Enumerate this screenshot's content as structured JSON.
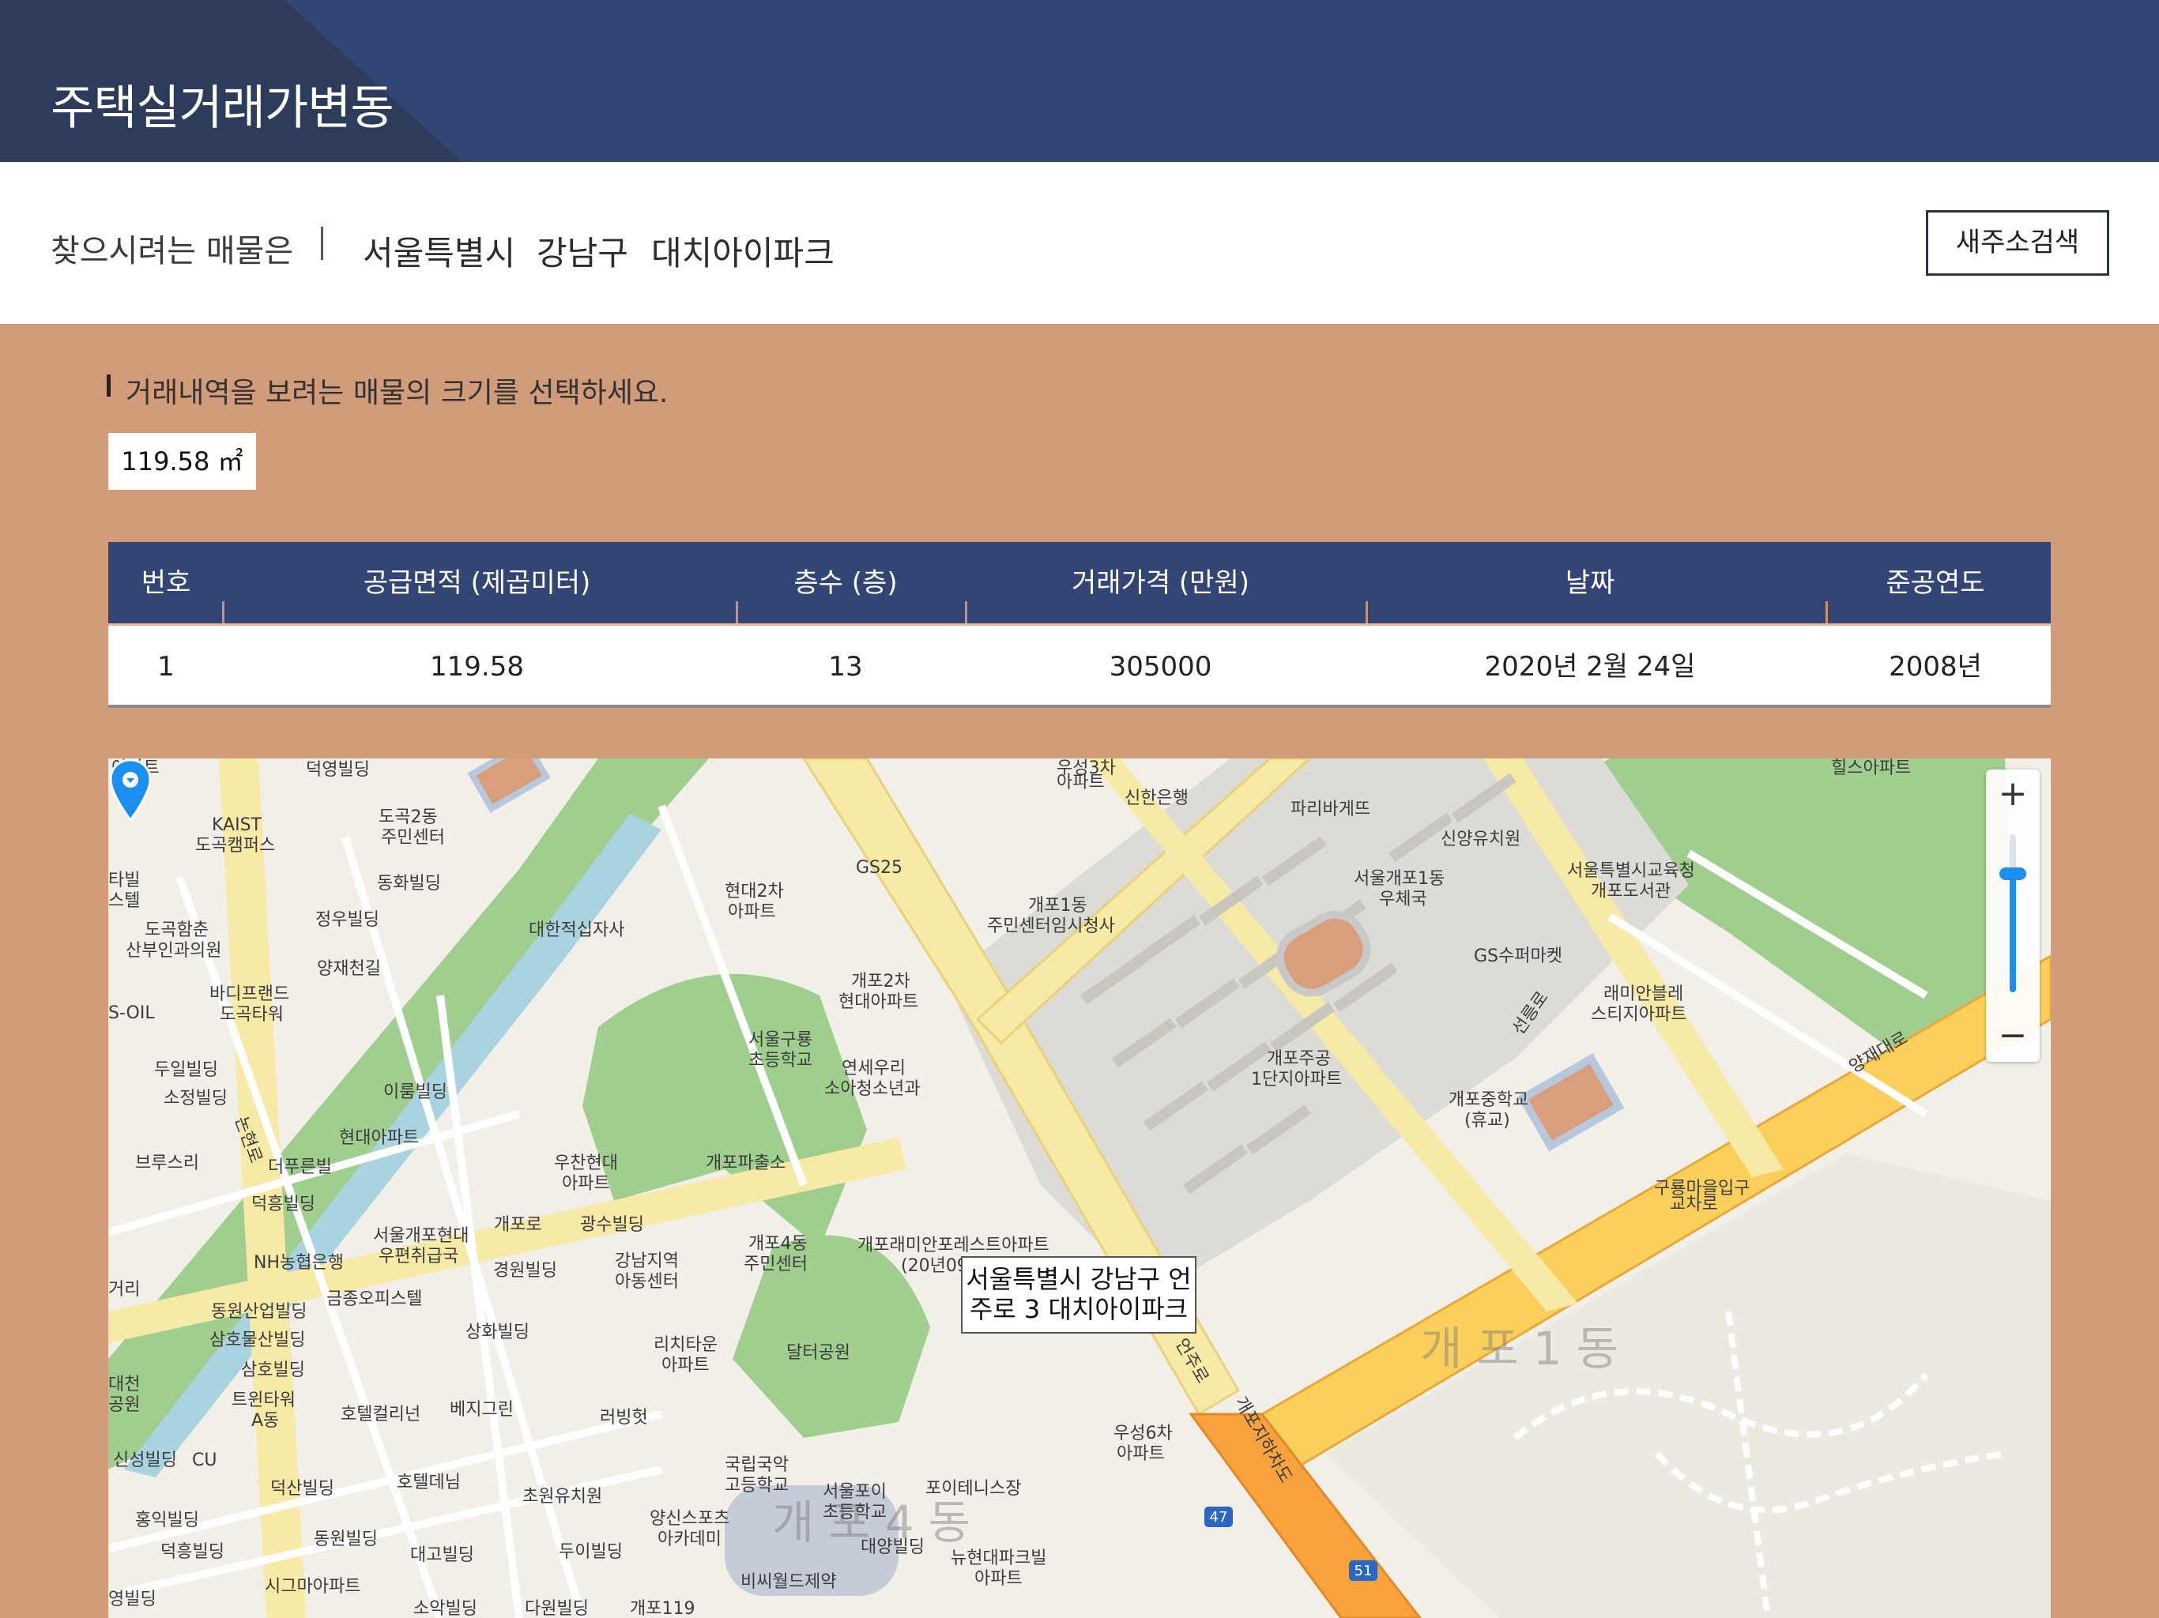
{
  "header": {
    "title": "주택실거래가변동"
  },
  "search": {
    "lead": "찾으시려는 매물은",
    "city": "서울특별시",
    "district": "강남구",
    "complex": "대치아이파크",
    "new_search_label": "새주소검색"
  },
  "size_select": {
    "instruction": "거래내역을 보려는 매물의 크기를 선택하세요.",
    "options": [
      "119.58 ㎡"
    ]
  },
  "table": {
    "headers": [
      "번호",
      "공급면적 (제곱미터)",
      "층수 (층)",
      "거래가격 (만원)",
      "날짜",
      "준공연도"
    ],
    "rows": [
      [
        "1",
        "119.58",
        "13",
        "305000",
        "2020년 2월 24일",
        "2008년"
      ]
    ]
  },
  "map": {
    "info_window": [
      "서울특별시 강남구 언",
      "주로 3 대치아이파크"
    ],
    "zoom_in": "+",
    "zoom_out": "−",
    "zoom_level": 0.75,
    "marker_color": "#1a8ff0",
    "labels": [
      "아파트",
      "덕영빌딩",
      "도곡2동",
      "주민센터",
      "KAIST",
      "도곡캠퍼스",
      "타빌",
      "스텔",
      "동화빌딩",
      "도곡함춘",
      "산부인과의원",
      "정우빌딩",
      "대한적십자사",
      "양재천길",
      "바디프랜드",
      "도곡타워",
      "S-OIL",
      "두일빌딩",
      "소정빌딩",
      "이룸빌딩",
      "현대아파트",
      "브루스리",
      "더푸른빌",
      "덕흥빌딩",
      "서울개포현대",
      "우편취급국",
      "NH농협은행",
      "광수빌딩",
      "개포로",
      "경원빌딩",
      "강남지역",
      "아동센터",
      "금종오피스텔",
      "동원산업빌딩",
      "삼호물산빌딩",
      "상화빌딩",
      "삼호빌딩",
      "트윈타워",
      "A동",
      "호텔컬리넌",
      "베지그린",
      "러빙헛",
      "신성빌딩",
      "CU",
      "덕산빌딩",
      "호텔데님",
      "초원유치원",
      "양신스포츠",
      "아카데미",
      "홍익빌딩",
      "동원빌딩",
      "덕흥빌딩",
      "대고빌딩",
      "두이빌딩",
      "시그마아파트",
      "영빌딩",
      "소악빌딩",
      "다원빌딩",
      "개포119",
      "비씨월드제약",
      "현대2차",
      "아파트",
      "GS25",
      "개포1동",
      "주민센터임시청사",
      "개포2차",
      "현대아파트",
      "서울구룡",
      "초등학교",
      "연세우리",
      "소아청소년과",
      "우찬현대",
      "아파트",
      "개포파출소",
      "개포4동",
      "주민센터",
      "개포래미안포레스트아파트",
      "(20년09",
      "리치타운",
      "아파트",
      "달터공원",
      "국립국악",
      "고등학교",
      "서울포이",
      "초등학교",
      "포이테니스장",
      "대양빌딩",
      "뉴현대파크빌",
      "아파트",
      "우성6차",
      "아파트",
      "우성3차",
      "아파트",
      "신한은행",
      "파리바게뜨",
      "신양유치원",
      "서울개포1동",
      "우체국",
      "서울특별시교육청",
      "개포도서관",
      "GS수퍼마켓",
      "래미안블레",
      "스티지아파트",
      "개포주공",
      "1단지아파트",
      "개포중학교",
      "(휴교)",
      "구룡마을입구",
      "교차로",
      "양재대로",
      "언주로",
      "개포지하차도",
      "선릉로",
      "논현로",
      "힐스아파트",
      "거리",
      "대천",
      "공원"
    ],
    "dong_labels": [
      "개포1동",
      "개포4동"
    ],
    "route_badges": [
      "47",
      "51"
    ]
  }
}
